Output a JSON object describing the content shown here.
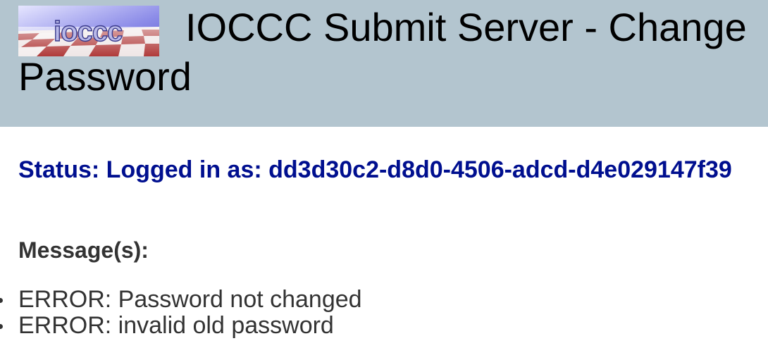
{
  "header": {
    "logo_text": "ioccc",
    "title": "IOCCC Submit Server - Change Password",
    "background_color": "#b3c5cf"
  },
  "status": {
    "text": "Status: Logged in as: dd3d30c2-d8d0-4506-adcd-d4e029147f39",
    "color": "#000f8f"
  },
  "messages": {
    "heading": "Message(s):",
    "items": [
      "ERROR: Password not changed",
      "ERROR: invalid old password"
    ]
  }
}
